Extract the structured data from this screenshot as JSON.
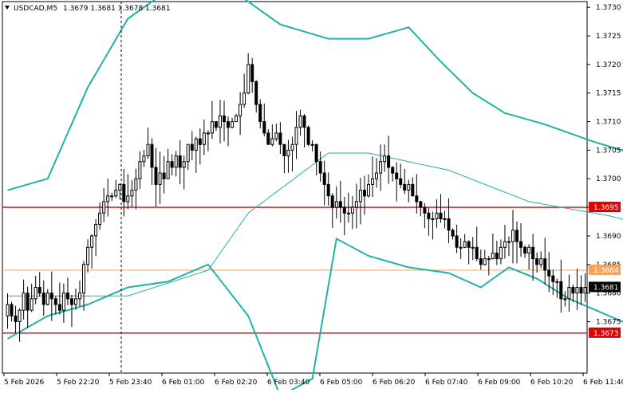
{
  "header": {
    "symbol": "USDCAD,M5",
    "ohlc": "1.3679 1.3681 1.3678 1.3681",
    "menu_icon": "triangle-down-icon"
  },
  "chart_data": {
    "type": "candlestick",
    "title": "USDCAD,M5",
    "ylim": [
      1.3666,
      1.3731
    ],
    "y_ticks": [
      "1.3730",
      "1.3725",
      "1.3720",
      "1.3715",
      "1.3710",
      "1.3705",
      "1.3700",
      "1.3695",
      "1.3690",
      "1.3685",
      "1.3680",
      "1.3675"
    ],
    "x_ticks": [
      "5 Feb 2026",
      "5 Feb 22:20",
      "5 Feb 23:40",
      "6 Feb 01:00",
      "6 Feb 02:20",
      "6 Feb 03:40",
      "6 Feb 05:00",
      "6 Feb 06:20",
      "6 Feb 07:40",
      "6 Feb 09:00",
      "6 Feb 10:20",
      "6 Feb 11:40"
    ],
    "current_price": "1.3681",
    "horizontal_lines": [
      {
        "label": "1.3695",
        "value": 1.3695,
        "color": "#e00000"
      },
      {
        "label": "1.3673",
        "value": 1.3673,
        "color": "#e00000"
      },
      {
        "label": "1.3684",
        "value": 1.3684,
        "color": "#f5a25d"
      }
    ],
    "candle_closes": [
      1.3678,
      1.3676,
      1.3675,
      1.3677,
      1.368,
      1.3677,
      1.3679,
      1.3681,
      1.368,
      1.3678,
      1.368,
      1.3679,
      1.3678,
      1.3677,
      1.368,
      1.3679,
      1.3678,
      1.3679,
      1.368,
      1.3685,
      1.3688,
      1.369,
      1.3692,
      1.3694,
      1.3696,
      1.3697,
      1.3697,
      1.3698,
      1.3699,
      1.3696,
      1.3697,
      1.3698,
      1.37,
      1.3703,
      1.3704,
      1.3706,
      1.3702,
      1.3699,
      1.3701,
      1.37,
      1.3703,
      1.3702,
      1.3704,
      1.3702,
      1.3703,
      1.3706,
      1.3705,
      1.3707,
      1.3706,
      1.3708,
      1.3708,
      1.371,
      1.3709,
      1.3711,
      1.371,
      1.3709,
      1.371,
      1.3711,
      1.3713,
      1.3715,
      1.372,
      1.3717,
      1.3713,
      1.371,
      1.3708,
      1.3706,
      1.3707,
      1.3708,
      1.3706,
      1.3704,
      1.3705,
      1.3706,
      1.3709,
      1.3711,
      1.3709,
      1.3706,
      1.3706,
      1.3703,
      1.3701,
      1.3699,
      1.3697,
      1.3695,
      1.3696,
      1.3695,
      1.3694,
      1.3694,
      1.3695,
      1.3696,
      1.3698,
      1.3697,
      1.3699,
      1.37,
      1.3701,
      1.3703,
      1.3704,
      1.3702,
      1.3701,
      1.37,
      1.3699,
      1.3698,
      1.3699,
      1.3697,
      1.3696,
      1.3695,
      1.3694,
      1.3693,
      1.3693,
      1.3694,
      1.3693,
      1.3693,
      1.3691,
      1.369,
      1.3688,
      1.3688,
      1.3689,
      1.3688,
      1.3688,
      1.3686,
      1.3685,
      1.3686,
      1.3686,
      1.3687,
      1.3686,
      1.3688,
      1.3689,
      1.3689,
      1.3691,
      1.3689,
      1.3688,
      1.3687,
      1.3688,
      1.3686,
      1.3685,
      1.3686,
      1.3684,
      1.3683,
      1.3682,
      1.3682,
      1.3679,
      1.3679,
      1.3681,
      1.368,
      1.3681,
      1.368,
      1.3681
    ],
    "candle_seed": 7,
    "bollinger": {
      "middle": [
        [
          0,
          1.36795
        ],
        [
          30,
          1.36795
        ],
        [
          50,
          1.3684
        ],
        [
          60,
          1.3694
        ],
        [
          80,
          1.37045
        ],
        [
          90,
          1.37045
        ],
        [
          110,
          1.37015
        ],
        [
          130,
          1.3696
        ],
        [
          150,
          1.36935
        ],
        [
          170,
          1.369
        ],
        [
          180,
          1.36845
        ]
      ],
      "upper": [
        [
          0,
          1.3698
        ],
        [
          10,
          1.37
        ],
        [
          20,
          1.3716
        ],
        [
          30,
          1.3728
        ],
        [
          40,
          1.3733
        ],
        [
          50,
          1.3736
        ],
        [
          56,
          1.3733
        ],
        [
          62,
          1.373
        ],
        [
          68,
          1.3727
        ],
        [
          80,
          1.37245
        ],
        [
          90,
          1.37245
        ],
        [
          100,
          1.37265
        ],
        [
          108,
          1.37205
        ],
        [
          116,
          1.3715
        ],
        [
          124,
          1.37115
        ],
        [
          134,
          1.37095
        ],
        [
          146,
          1.37065
        ],
        [
          158,
          1.3704
        ],
        [
          175,
          1.37015
        ]
      ],
      "lower": [
        [
          0,
          1.3672
        ],
        [
          10,
          1.3676
        ],
        [
          20,
          1.3678
        ],
        [
          30,
          1.3681
        ],
        [
          40,
          1.3682
        ],
        [
          50,
          1.3685
        ],
        [
          60,
          1.3676
        ],
        [
          68,
          1.3662
        ],
        [
          76,
          1.3665
        ],
        [
          82,
          1.36895
        ],
        [
          90,
          1.36865
        ],
        [
          100,
          1.36845
        ],
        [
          110,
          1.36835
        ],
        [
          118,
          1.3681
        ],
        [
          125,
          1.36845
        ],
        [
          132,
          1.36825
        ],
        [
          140,
          1.3679
        ],
        [
          150,
          1.3676
        ],
        [
          160,
          1.3673
        ],
        [
          170,
          1.36715
        ],
        [
          178,
          1.36715
        ]
      ]
    },
    "vertical_marker": {
      "category": "5 Feb 23:40",
      "style": "dashed"
    },
    "colors": {
      "candle": "#000000",
      "band": "#20b2aa",
      "middle_band": "#20b2aa",
      "red_line": "#e00000",
      "orange_line": "#f5a25d",
      "price_tag_bg": "#000000"
    }
  }
}
